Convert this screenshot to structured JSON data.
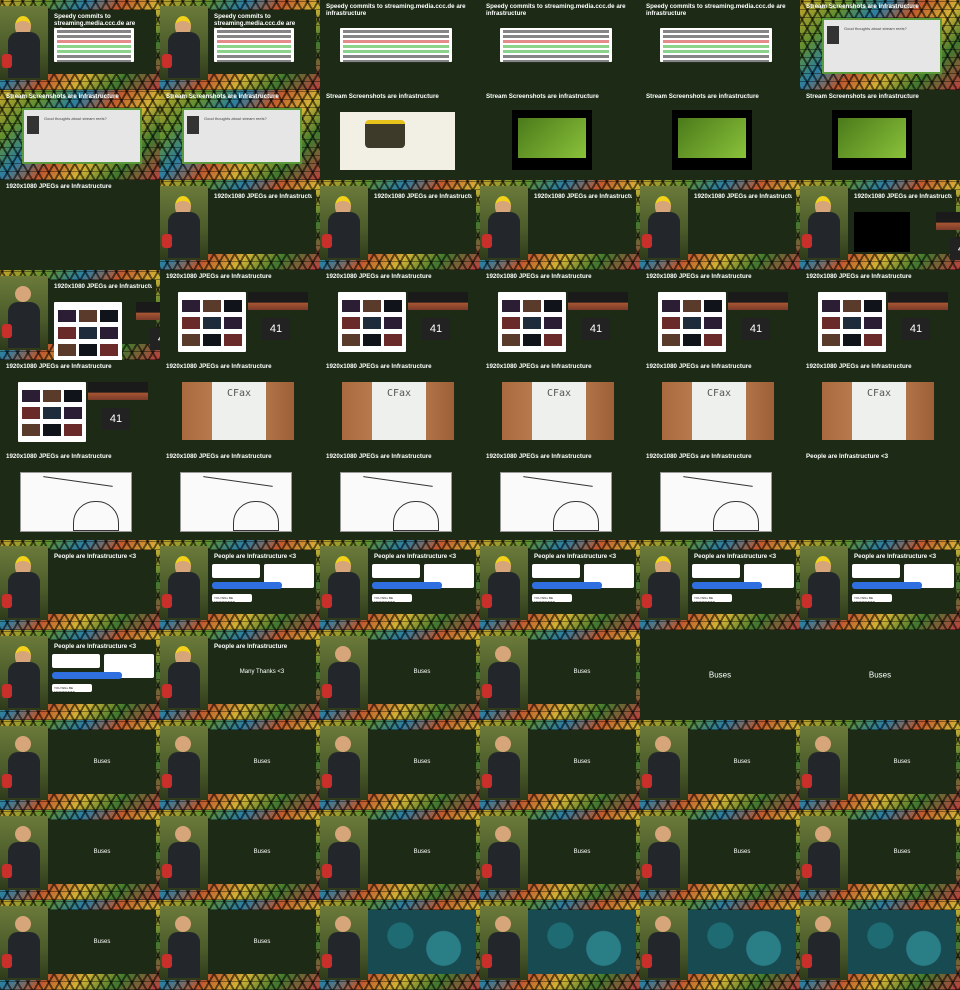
{
  "tiles": [
    {
      "t": "Speedy commits to streaming.media.ccc.de are infrastructure",
      "k": "speaker-code"
    },
    {
      "t": "Speedy commits to streaming.media.ccc.de are infrastructure",
      "k": "speaker-code"
    },
    {
      "t": "Speedy commits to streaming.media.ccc.de are infrastructure",
      "k": "code"
    },
    {
      "t": "Speedy commits to streaming.media.ccc.de are infrastructure",
      "k": "code"
    },
    {
      "t": "Speedy commits to streaming.media.ccc.de are infrastructure",
      "k": "code"
    },
    {
      "t": "Stream Screenshots are infrastructure",
      "k": "screenshot-framed"
    },
    {
      "t": "Stream Screenshots are infrastructure",
      "k": "screenshot-framed"
    },
    {
      "t": "Stream Screenshots are infrastructure",
      "k": "screenshot-framed"
    },
    {
      "t": "Stream Screenshots are infrastructure",
      "k": "projector"
    },
    {
      "t": "Stream Screenshots are infrastructure",
      "k": "stage"
    },
    {
      "t": "Stream Screenshots are infrastructure",
      "k": "stage"
    },
    {
      "t": "Stream Screenshots are infrastructure",
      "k": "stage"
    },
    {
      "t": "1920x1080 JPEGs are Infrastructure",
      "k": "plain-title"
    },
    {
      "t": "1920x1080 JPEGs are Infrastructure",
      "k": "speaker-empty"
    },
    {
      "t": "1920x1080 JPEGs are Infrastructure",
      "k": "speaker-empty"
    },
    {
      "t": "1920x1080 JPEGs are Infrastructure",
      "k": "speaker-empty"
    },
    {
      "t": "1920x1080 JPEGs are Infrastructure",
      "k": "speaker-empty"
    },
    {
      "t": "1920x1080 JPEGs are Infrastructure",
      "k": "speaker-meter"
    },
    {
      "t": "1920x1080 JPEGs are Infrastructure",
      "k": "speaker-gallery"
    },
    {
      "t": "1920x1080 JPEGs are Infrastructure",
      "k": "gallery"
    },
    {
      "t": "1920x1080 JPEGs are Infrastructure",
      "k": "gallery"
    },
    {
      "t": "1920x1080 JPEGs are Infrastructure",
      "k": "gallery"
    },
    {
      "t": "1920x1080 JPEGs are Infrastructure",
      "k": "gallery"
    },
    {
      "t": "1920x1080 JPEGs are Infrastructure",
      "k": "gallery"
    },
    {
      "t": "1920x1080 JPEGs are Infrastructure",
      "k": "gallery"
    },
    {
      "t": "1920x1080 JPEGs are Infrastructure",
      "k": "cfax"
    },
    {
      "t": "1920x1080 JPEGs are Infrastructure",
      "k": "cfax"
    },
    {
      "t": "1920x1080 JPEGs are Infrastructure",
      "k": "cfax"
    },
    {
      "t": "1920x1080 JPEGs are Infrastructure",
      "k": "cfax"
    },
    {
      "t": "1920x1080 JPEGs are Infrastructure",
      "k": "cfax"
    },
    {
      "t": "1920x1080 JPEGs are Infrastructure",
      "k": "sketch"
    },
    {
      "t": "1920x1080 JPEGs are Infrastructure",
      "k": "sketch"
    },
    {
      "t": "1920x1080 JPEGs are Infrastructure",
      "k": "sketch"
    },
    {
      "t": "1920x1080 JPEGs are Infrastructure",
      "k": "sketch"
    },
    {
      "t": "1920x1080 JPEGs are Infrastructure",
      "k": "sketch"
    },
    {
      "t": "People are Infrastructure <3",
      "k": "plain-title"
    },
    {
      "t": "People are Infrastructure <3",
      "k": "speaker-empty"
    },
    {
      "t": "People are Infrastructure <3",
      "k": "speaker-chat"
    },
    {
      "t": "People are Infrastructure <3",
      "k": "speaker-chat"
    },
    {
      "t": "People are Infrastructure <3",
      "k": "speaker-chat"
    },
    {
      "t": "People are Infrastructure <3",
      "k": "speaker-chat"
    },
    {
      "t": "People are Infrastructure <3",
      "k": "speaker-chat"
    },
    {
      "t": "People are Infrastructure <3",
      "k": "speaker-chat"
    },
    {
      "t": "People are Infrastructure",
      "k": "speaker-thanks"
    },
    {
      "t": "",
      "k": "speaker-buses"
    },
    {
      "t": "",
      "k": "speaker-buses"
    },
    {
      "t": "",
      "k": "buses-full"
    },
    {
      "t": "",
      "k": "buses-full"
    },
    {
      "t": "",
      "k": "speaker-buses"
    },
    {
      "t": "",
      "k": "speaker-buses"
    },
    {
      "t": "",
      "k": "speaker-buses"
    },
    {
      "t": "",
      "k": "speaker-buses"
    },
    {
      "t": "",
      "k": "speaker-buses"
    },
    {
      "t": "",
      "k": "speaker-buses"
    },
    {
      "t": "",
      "k": "speaker-buses"
    },
    {
      "t": "",
      "k": "speaker-buses"
    },
    {
      "t": "",
      "k": "speaker-buses"
    },
    {
      "t": "",
      "k": "speaker-buses"
    },
    {
      "t": "",
      "k": "speaker-buses"
    },
    {
      "t": "",
      "k": "speaker-buses"
    },
    {
      "t": "",
      "k": "speaker-buses"
    },
    {
      "t": "",
      "k": "speaker-buses"
    },
    {
      "t": "",
      "k": "speaker-map"
    },
    {
      "t": "",
      "k": "speaker-map"
    },
    {
      "t": "",
      "k": "speaker-map"
    },
    {
      "t": "",
      "k": "speaker-map"
    }
  ],
  "labels": {
    "buses": "Buses",
    "thanks": "Many Thanks <3",
    "meter_value": "41",
    "cfax": "CFax",
    "chat_line": "YOU WILL BE ENTERTAINED",
    "question": "Good thoughts about stream reels?"
  }
}
